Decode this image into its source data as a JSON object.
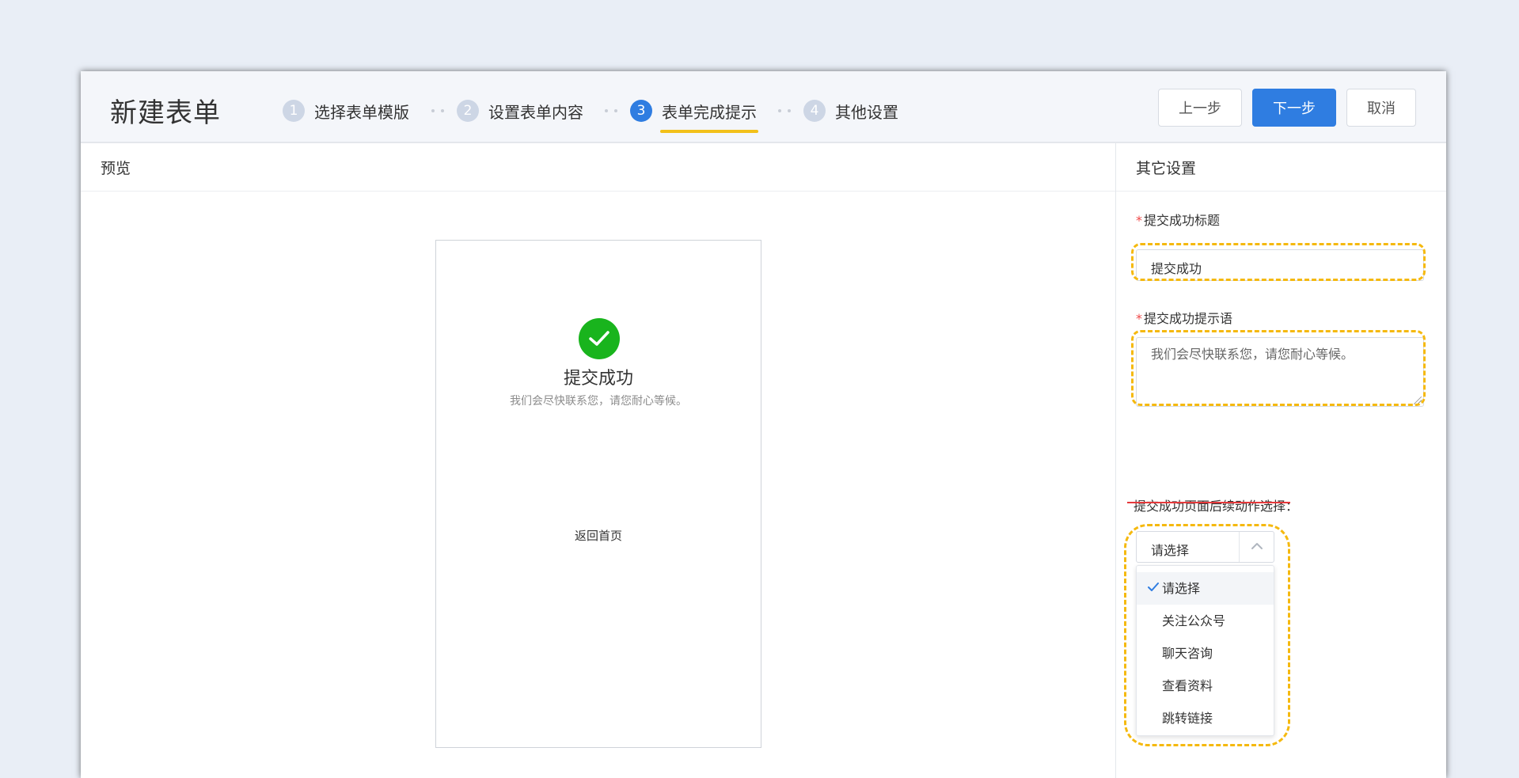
{
  "header": {
    "title": "新建表单",
    "steps": [
      {
        "num": "1",
        "label": "选择表单模版"
      },
      {
        "num": "2",
        "label": "设置表单内容"
      },
      {
        "num": "3",
        "label": "表单完成提示"
      },
      {
        "num": "4",
        "label": "其他设置"
      }
    ],
    "active_step": 3,
    "buttons": {
      "prev": "上一步",
      "next": "下一步",
      "cancel": "取消"
    }
  },
  "preview": {
    "title": "预览",
    "success_title": "提交成功",
    "success_message": "我们会尽快联系您，请您耐心等候。",
    "back_home": "返回首页"
  },
  "settings": {
    "title": "其它设置",
    "required_mark": "*",
    "success_title_label": "提交成功标题",
    "success_title_value": "提交成功",
    "success_tip_label": "提交成功提示语",
    "success_tip_value": "我们会尽快联系您，请您耐心等候。",
    "follow_action_label": "提交成功页面后续动作选择：",
    "select_value": "请选择",
    "options": [
      "请选择",
      "关注公众号",
      "聊天咨询",
      "查看资料",
      "跳转链接"
    ],
    "selected_option": "请选择"
  },
  "colors": {
    "primary": "#2f7de1",
    "success": "#19b41d",
    "highlight_dash": "#f5b90f",
    "active_underline": "#f2c019",
    "required": "#f04848"
  },
  "icons": [
    "check-circle-icon",
    "chevron-up-icon",
    "checkmark-icon"
  ]
}
